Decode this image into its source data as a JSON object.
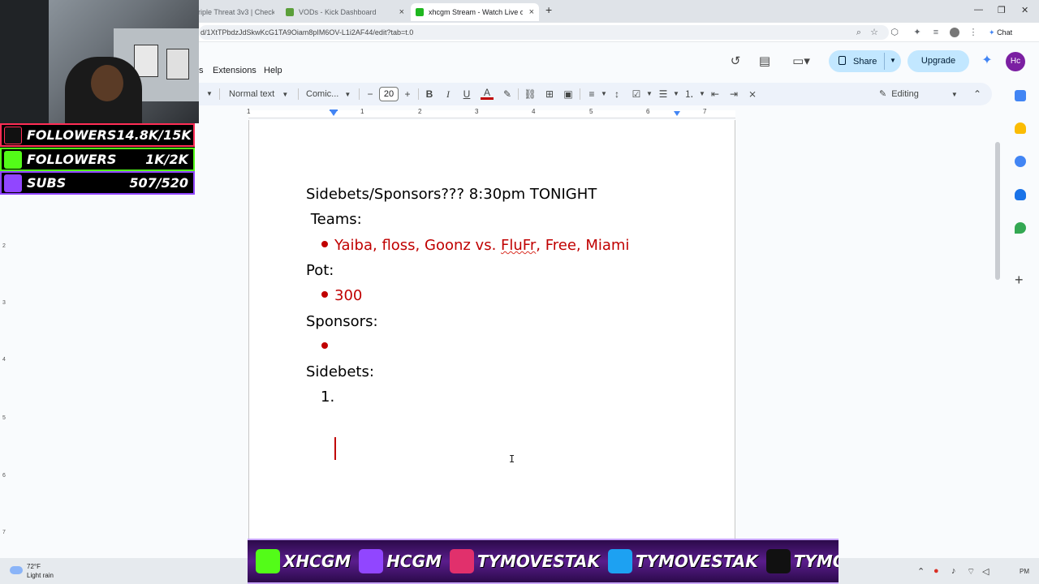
{
  "browser": {
    "tabs": [
      {
        "label": "riple Threat 3v3 | Check"
      },
      {
        "label": "VODs - Kick Dashboard"
      },
      {
        "label": "xhcgm Stream - Watch Live on Kick"
      }
    ],
    "new_tab": "+",
    "url": "d/1XtTPbdzJdSkwKcG1TA9Oiam8pIM6OV-L1i2AF44/edit?tab=t.0",
    "chat_label": "Chat",
    "window_controls": {
      "minimize": "—",
      "restore": "❐",
      "close": "✕"
    }
  },
  "docs": {
    "menu": [
      "s",
      "Extensions",
      "Help"
    ],
    "share_label": "Share",
    "upgrade_label": "Upgrade",
    "avatar_initials": "Hc",
    "toolbar": {
      "style": "Normal text",
      "font": "Comic...",
      "font_size": "20",
      "editing_label": "Editing"
    },
    "ruler_numbers": [
      "1",
      "1",
      "2",
      "3",
      "4",
      "5",
      "6",
      "7"
    ],
    "vertical_ruler_numbers": [
      "2",
      "3",
      "4",
      "5",
      "6",
      "7"
    ],
    "content": {
      "title": "Sidebets/Sponsors??? 8:30pm TONIGHT",
      "teams_label": " Teams:",
      "teams_part1": "Yaiba, floss, Goonz vs. ",
      "teams_flagged": "FluFr",
      "teams_part2": ", Free, Miami",
      "pot_label": "Pot:",
      "pot_value": "300",
      "sponsors_label": "Sponsors:",
      "sidebets_label": "Sidebets:",
      "list_number": "1."
    }
  },
  "overlay": {
    "stats": [
      {
        "label": "FOLLOWERS",
        "value": "14.8K/15K",
        "color": "#ff2d55"
      },
      {
        "label": "FOLLOWERS",
        "value": "1K/2K",
        "color": "#53fc18"
      },
      {
        "label": "SUBS",
        "value": "507/520",
        "color": "#9146ff"
      }
    ],
    "banner": [
      {
        "text": "XHCGM",
        "icon_color": "#53fc18"
      },
      {
        "text": "HCGM",
        "icon_color": "#9146ff"
      },
      {
        "text": "TYMOVESTAK",
        "icon_color": "#e1306c"
      },
      {
        "text": "TYMOVESTAK",
        "icon_color": "#1da1f2"
      },
      {
        "text": "TYMOVESTAK",
        "icon_color": "#111111"
      }
    ]
  },
  "taskbar": {
    "temperature": "72°F",
    "weather": "Light rain",
    "clock": "PM"
  }
}
